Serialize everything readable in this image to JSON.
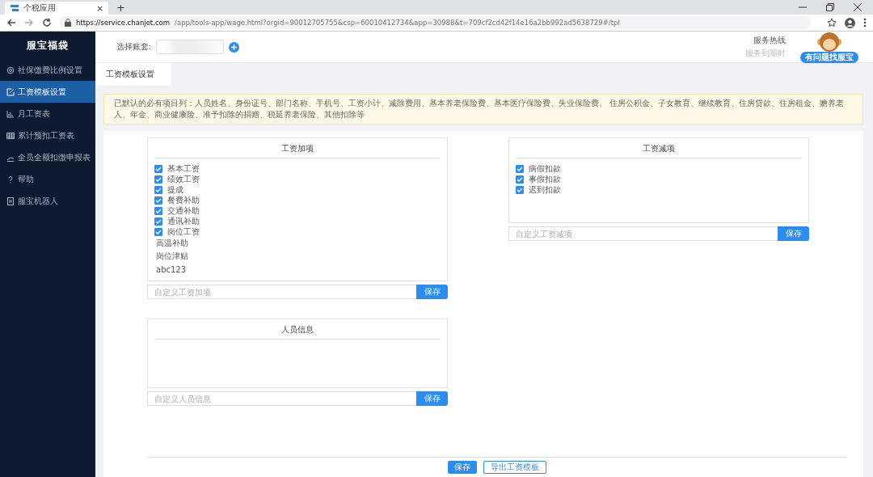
{
  "browser": {
    "tab_title": "个税应用",
    "tab_close": "×",
    "new_tab": "+",
    "url_host": "https://service.chanjet.com",
    "url_path": "/app/tools-app/wage.html?orgid=90012705755&csp=60010412734&app=30988&t=709cf2cd42f14e16a2bb992ad5638729#/tpl"
  },
  "sidebar": {
    "logo": "服宝福袋",
    "items": [
      {
        "label": "社保缴费比例设置",
        "selected": false
      },
      {
        "label": "工资模板设置",
        "selected": true
      },
      {
        "label": "月工资表",
        "selected": false
      },
      {
        "label": "累计预扣工资表",
        "selected": false
      },
      {
        "label": "全员全额扣缴申报表",
        "selected": false
      },
      {
        "label": "帮助",
        "selected": false
      },
      {
        "label": "服宝机器人",
        "selected": false
      }
    ]
  },
  "header": {
    "account_label": "选择账套:",
    "hotline": "服务热线",
    "expiry": "服务到期时",
    "help_badge": "有问题找服宝"
  },
  "page_title": "工资模板设置",
  "notice": "已默认的必有项目列：人员姓名、身份证号、部门名称、手机号、工资小计、减除费用、基本养老保险费、基本医疗保险费、失业保险费、 住房公积金、子女教育、继续教育、住房贷款、住房租金、赡养老人、年金、商业健康险、准予扣除的捐赠、税延养老保险、其他扣除等",
  "panels": [
    {
      "title": "工资加项",
      "items": [
        {
          "kind": "checkbox",
          "label": "基本工资",
          "checked": true
        },
        {
          "kind": "checkbox",
          "label": "绩效工资",
          "checked": true
        },
        {
          "kind": "checkbox",
          "label": "提成",
          "checked": true
        },
        {
          "kind": "checkbox",
          "label": "餐费补助",
          "checked": true
        },
        {
          "kind": "checkbox",
          "label": "交通补助",
          "checked": true
        },
        {
          "kind": "checkbox",
          "label": "通讯补助",
          "checked": true
        },
        {
          "kind": "checkbox",
          "label": "岗位工资",
          "checked": true
        },
        {
          "kind": "text",
          "label": "高温补助"
        },
        {
          "kind": "text",
          "label": "岗位津贴"
        },
        {
          "kind": "text",
          "label": "abc123"
        }
      ],
      "placeholder": "自定义工资加项",
      "button": "保存"
    },
    {
      "title": "工资减项",
      "items": [
        {
          "kind": "checkbox",
          "label": "病假扣款",
          "checked": true
        },
        {
          "kind": "checkbox",
          "label": "事假扣款",
          "checked": true
        },
        {
          "kind": "checkbox",
          "label": "迟到扣款",
          "checked": true
        }
      ],
      "placeholder": "自定义工资减项",
      "button": "保存"
    },
    {
      "title": "人员信息",
      "placeholder": "自定义人员信息",
      "button": "保存"
    }
  ],
  "footer_buttons": [
    {
      "label": "保存",
      "kind": "primary"
    },
    {
      "label": "导出工资模板",
      "kind": "outline"
    }
  ]
}
